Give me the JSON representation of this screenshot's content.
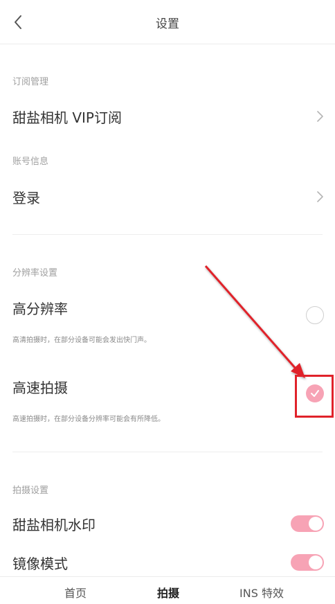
{
  "header": {
    "title": "设置"
  },
  "sections": {
    "subscription": {
      "label": "订阅管理",
      "item": "甜盐相机 VIP订阅"
    },
    "account": {
      "label": "账号信息",
      "item": "登录"
    },
    "resolution": {
      "label": "分辨率设置",
      "high_res": {
        "title": "高分辨率",
        "desc": "高清拍摄时，在部分设备可能会发出快门声。",
        "selected": false
      },
      "high_speed": {
        "title": "高速拍摄",
        "desc": "高速拍摄时，在部分设备分辨率可能会有所降低。",
        "selected": true
      }
    },
    "shooting": {
      "label": "拍摄设置",
      "watermark": {
        "title": "甜盐相机水印",
        "enabled": true
      },
      "mirror": {
        "title": "镜像模式",
        "enabled": true
      }
    }
  },
  "bottom_nav": {
    "items": [
      "首页",
      "拍摄",
      "INS 特效"
    ],
    "active_index": 1
  },
  "colors": {
    "accent_pink": "#f7a3b5",
    "annotation_red": "#e0222a"
  }
}
